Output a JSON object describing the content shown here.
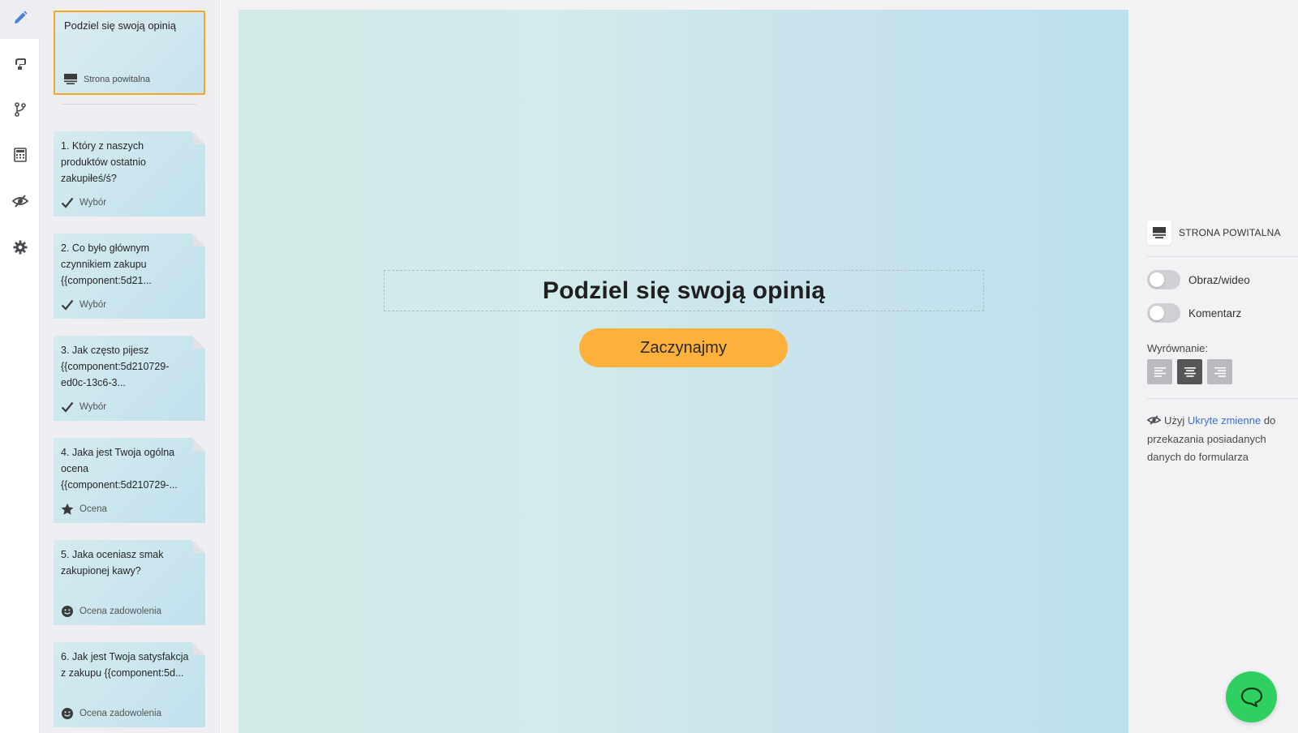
{
  "sidebar_icons": [
    {
      "name": "pencil-icon",
      "active": true
    },
    {
      "name": "theme-icon"
    },
    {
      "name": "logic-branch-icon"
    },
    {
      "name": "calculator-icon"
    },
    {
      "name": "hidden-variables-icon"
    },
    {
      "name": "settings-gear-icon"
    }
  ],
  "questions_panel": {
    "welcome_card": {
      "title": "Podziel się swoją opinią",
      "type_label": "Strona powitalna",
      "type_icon": "screen-icon"
    },
    "questions": [
      {
        "text": "1. Który z naszych produktów ostatnio zakupiłeś/ś?",
        "type": "Wybór",
        "type_icon": "check-icon"
      },
      {
        "text": "2. Co było głównym czynnikiem zakupu {{component:5d21...",
        "type": "Wybór",
        "type_icon": "check-icon"
      },
      {
        "text": "3. Jak często pijesz {{component:5d210729-ed0c-13c6-3...",
        "type": "Wybór",
        "type_icon": "check-icon"
      },
      {
        "text": "4. Jaka jest Twoja ogólna ocena {{component:5d210729-...",
        "type": "Ocena",
        "type_icon": "star-icon"
      },
      {
        "text": "5. Jaka oceniasz smak zakupionej kawy?",
        "type": "Ocena zadowolenia",
        "type_icon": "smiley-icon"
      },
      {
        "text": "6. Jak jest Twoja satysfakcja z zakupu {{component:5d...",
        "type": "Ocena zadowolenia",
        "type_icon": "smiley-icon"
      }
    ]
  },
  "canvas": {
    "title": "Podziel się swoją opinią",
    "start_button": "Zaczynajmy",
    "button_color": "#fdb13b"
  },
  "settings_panel": {
    "header": "STRONA POWITALNA",
    "toggles": [
      {
        "label": "Obraz/wideo",
        "on": false
      },
      {
        "label": "Komentarz",
        "on": false
      }
    ],
    "alignment_label": "Wyrównanie:",
    "alignment_options": [
      "left",
      "center",
      "right"
    ],
    "alignment_selected": "center",
    "hint": {
      "prefix": "Użyj",
      "link": "Ukryte zmienne",
      "suffix": "do przekazania posiadanych danych do formularza"
    }
  },
  "colors": {
    "accent_orange": "#f5a623",
    "link_blue": "#3a6fd8",
    "chat_green": "#2fd05f"
  }
}
